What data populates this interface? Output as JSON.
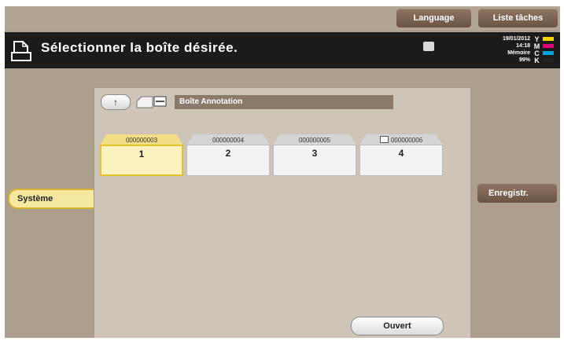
{
  "topbar": {
    "language_label": "Language",
    "tasks_label": "Liste tâches"
  },
  "header": {
    "title": "Sélectionner la boîte désirée.",
    "date": "19/01/2012",
    "time": "14:18",
    "memory_label": "Mémoire",
    "memory_value": "99%",
    "toner": [
      {
        "letter": "Y",
        "color": "#f5d400"
      },
      {
        "letter": "M",
        "color": "#e0007a"
      },
      {
        "letter": "C",
        "color": "#00a0e0"
      },
      {
        "letter": "K",
        "color": "#222222"
      }
    ]
  },
  "sidebar": {
    "selected_label": "Système"
  },
  "main": {
    "box_type": "Boîte Annotation",
    "boxes": [
      {
        "tab": "000000003",
        "number": "1",
        "selected": true,
        "locked": false
      },
      {
        "tab": "000000004",
        "number": "2",
        "selected": false,
        "locked": false
      },
      {
        "tab": "000000005",
        "number": "3",
        "selected": false,
        "locked": false
      },
      {
        "tab": "000000006",
        "number": "4",
        "selected": false,
        "locked": true
      }
    ],
    "open_label": "Ouvert"
  },
  "right_panel": {
    "register_label": "Enregistr."
  }
}
